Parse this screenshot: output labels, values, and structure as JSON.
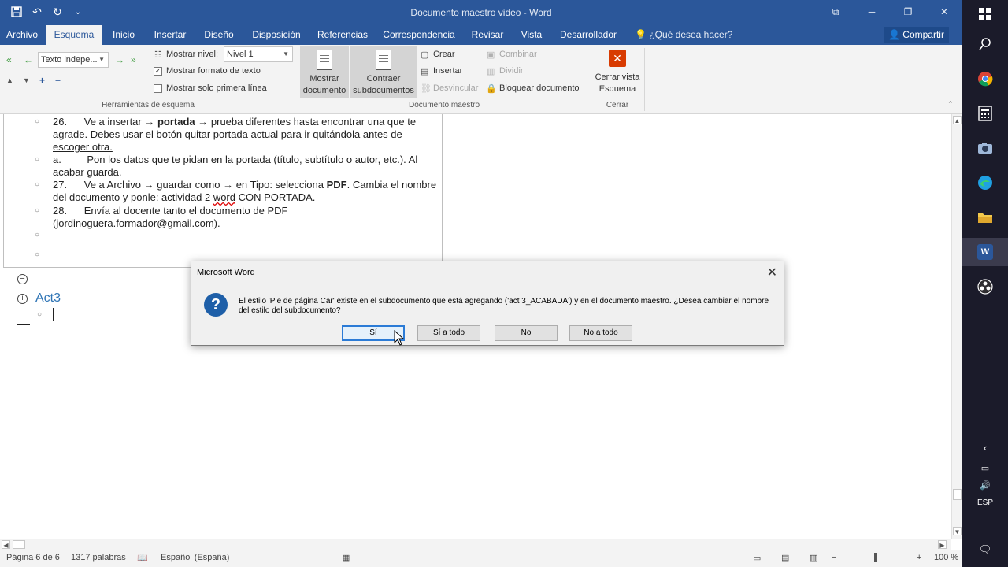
{
  "window": {
    "title": "Documento maestro video - Word",
    "controls": [
      "⧉",
      "─",
      "❐",
      "✕"
    ]
  },
  "qat": {
    "save_icon": "save-icon",
    "undo_icon": "undo-icon",
    "redo_icon": "redo-icon",
    "customize_icon": "customize-icon"
  },
  "tabs": [
    {
      "label": "Archivo"
    },
    {
      "label": "Esquema"
    },
    {
      "label": "Inicio"
    },
    {
      "label": "Insertar"
    },
    {
      "label": "Diseño"
    },
    {
      "label": "Disposición"
    },
    {
      "label": "Referencias"
    },
    {
      "label": "Correspondencia"
    },
    {
      "label": "Revisar"
    },
    {
      "label": "Vista"
    },
    {
      "label": "Desarrollador"
    }
  ],
  "tell_me": "¿Qué desea hacer?",
  "share": "Compartir",
  "ribbon": {
    "outline_tools": {
      "label": "Herramientas de esquema",
      "level_select": "Texto indepe...",
      "show_level_label": "Mostrar nivel:",
      "show_level_value": "Nivel 1",
      "show_text_formatting": "Mostrar formato de texto",
      "show_text_formatting_checked": true,
      "show_first_line_only": "Mostrar solo primera línea",
      "show_first_line_only_checked": false
    },
    "master_document": {
      "label": "Documento maestro",
      "show_document": "Mostrar documento",
      "collapse_subdocuments": "Contraer subdocumentos",
      "create": "Crear",
      "insert": "Insertar",
      "unlink": "Desvincular",
      "merge": "Combinar",
      "split": "Dividir",
      "lock_document": "Bloquear documento"
    },
    "close": {
      "label": "Cerrar",
      "close_outline_view": "Cerrar vista Esquema"
    }
  },
  "document": {
    "items": [
      {
        "num": "26.",
        "text_a": "Ve a insertar ",
        "bold_a": "portada",
        "text_b": " prueba diferentes hasta encontrar una que te agrade. ",
        "underline": "Debes usar el botón quitar portada actual para ir quitándola antes de escoger otra."
      },
      {
        "num": "a.",
        "text": "Pon los datos que te pidan en la portada (título, subtítulo o autor, etc.). Al acabar guarda."
      },
      {
        "num": "27.",
        "text_a": "Ve a Archivo ",
        "text_b": " guardar como ",
        "text_c": " en Tipo: selecciona ",
        "bold": "PDF",
        "text_d": ". Cambia el nombre del documento y ponle: actividad 2 ",
        "squiggle": "word",
        "text_e": " CON PORTADA."
      },
      {
        "num": "28.",
        "text": "Envía al docente tanto el documento de PDF (jordinoguera.formador@gmail.com)."
      }
    ],
    "arrow": "→",
    "heading": "Act3"
  },
  "dialog": {
    "title": "Microsoft Word",
    "message": "El estilo 'Pie de página Car' existe en el subdocumento que está agregando ('act 3_ACABADA') y en el documento maestro. ¿Desea cambiar el nombre del estilo del subdocumento?",
    "buttons": [
      "Sí",
      "Sí a todo",
      "No",
      "No a todo"
    ]
  },
  "status": {
    "page": "Página 6 de 6",
    "words": "1317 palabras",
    "language": "Español (España)",
    "zoom": "100 %"
  },
  "taskbar": {
    "language": "ESP",
    "apps": [
      "windows-start-icon",
      "search-icon",
      "chrome-icon",
      "calculator-icon",
      "camera-icon",
      "edge-icon",
      "file-explorer-icon",
      "word-icon",
      "obs-icon"
    ]
  }
}
